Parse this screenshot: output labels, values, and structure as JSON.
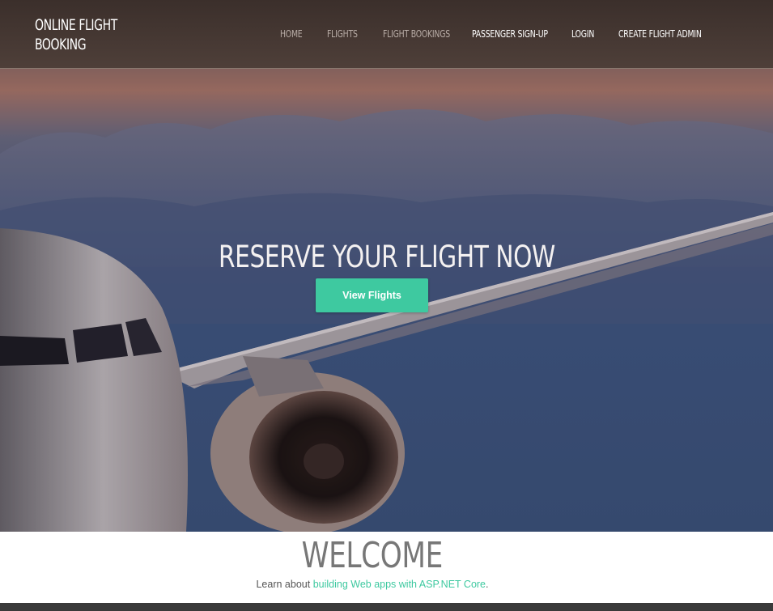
{
  "navbar": {
    "brand": "ONLINE FLIGHT\nBOOKING",
    "items": [
      {
        "label": "HOME",
        "state": "dim"
      },
      {
        "label": "FLIGHTS",
        "state": "dim"
      },
      {
        "label": "FLIGHT BOOKINGS",
        "state": "dim"
      },
      {
        "label": "PASSENGER SIGN-UP",
        "state": "bright"
      },
      {
        "label": "LOGIN",
        "state": "bright"
      },
      {
        "label": "CREATE FLIGHT ADMIN",
        "state": "bright"
      }
    ]
  },
  "hero": {
    "title": "RESERVE YOUR FLIGHT NOW",
    "button_label": "View Flights"
  },
  "welcome": {
    "heading": "WELCOME",
    "text_prefix": "Learn about ",
    "link_text": "building Web apps with ASP.NET Core",
    "text_suffix": "."
  },
  "colors": {
    "accent": "#3ec9a0",
    "navbar_bg": "#3b2f2b",
    "nav_dim": "#b8aca6",
    "nav_bright": "#ffffff"
  }
}
